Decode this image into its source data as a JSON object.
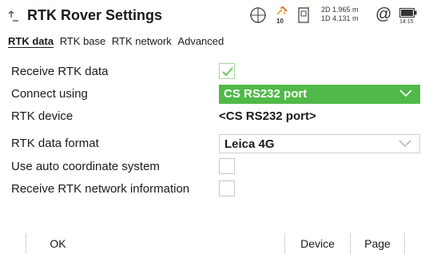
{
  "header": {
    "title": "RTK Rover Settings",
    "satellite_count": "10",
    "precision_2d": "2D 1.965 m",
    "precision_1d": "1D 4.131 m",
    "clock": "14:15",
    "icons": [
      "back-icon",
      "satellite-icon",
      "rtk-link-icon",
      "device-icon",
      "at-icon",
      "battery-icon"
    ],
    "rtk_icon_color": "#e8a33a"
  },
  "tabs": [
    {
      "label": "RTK data",
      "active": true
    },
    {
      "label": "RTK base",
      "active": false
    },
    {
      "label": "RTK network",
      "active": false
    },
    {
      "label": "Advanced",
      "active": false
    }
  ],
  "form": {
    "receive_rtk": {
      "label": "Receive RTK data",
      "checked": true
    },
    "connect_using": {
      "label": "Connect using",
      "value": "CS RS232 port"
    },
    "rtk_device": {
      "label": "RTK device",
      "value": "<CS RS232 port>"
    },
    "rtk_format": {
      "label": "RTK data format",
      "value": "Leica 4G"
    },
    "auto_coord": {
      "label": "Use auto coordinate system",
      "checked": false
    },
    "network_info": {
      "label": "Receive RTK network information",
      "checked": false
    }
  },
  "softkeys": {
    "ok": "OK",
    "device": "Device",
    "page": "Page"
  },
  "colors": {
    "accent_green": "#50b948",
    "check_green": "#6cc464"
  }
}
